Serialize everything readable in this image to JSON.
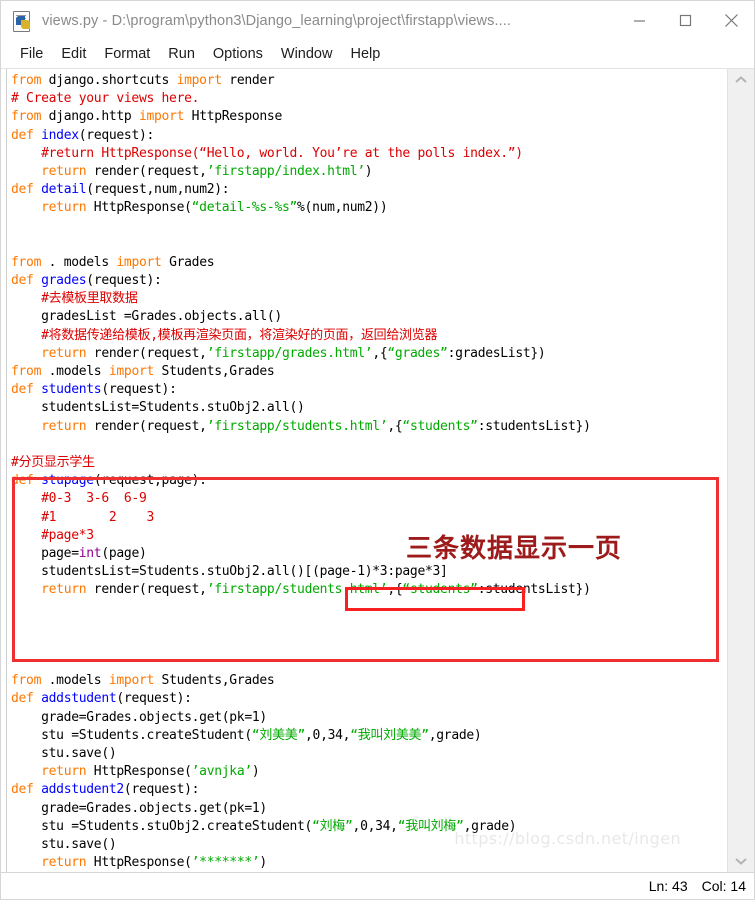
{
  "window": {
    "title": "views.py - D:\\program\\python3\\Django_learning\\project\\firstapp\\views....",
    "icon": "python-file-icon",
    "minimize_label": "—",
    "maximize_label": "□",
    "close_label": "✕"
  },
  "menubar": {
    "items": [
      {
        "label": "File"
      },
      {
        "label": "Edit"
      },
      {
        "label": "Format"
      },
      {
        "label": "Run"
      },
      {
        "label": "Options"
      },
      {
        "label": "Window"
      },
      {
        "label": "Help"
      }
    ]
  },
  "annotations": {
    "note_text": "三条数据显示一页",
    "note_color": "#9e1b1b",
    "outer_box_color": "#f03030",
    "inner_box_color": "#f82020",
    "watermark": "https://blog.csdn.net/ingen"
  },
  "statusbar": {
    "line_label": "Ln: 43",
    "col_label": "Col: 14"
  },
  "scrollbar": {
    "up_arrow": "chevron-up",
    "down_arrow": "chevron-down"
  },
  "colors": {
    "keyword": "#ff7700",
    "definition": "#0000ff",
    "string": "#00aa00",
    "comment": "#dd0000",
    "builtin": "#900090",
    "plain": "#000000"
  },
  "editor": {
    "lines": [
      {
        "n": 1,
        "segs": [
          {
            "t": "from",
            "c": "kw"
          },
          {
            "t": " django.shortcuts ",
            "c": "pl"
          },
          {
            "t": "import",
            "c": "kw"
          },
          {
            "t": " render",
            "c": "pl"
          }
        ]
      },
      {
        "n": 2,
        "segs": [
          {
            "t": "# Create your views here.",
            "c": "cmt"
          }
        ]
      },
      {
        "n": 3,
        "segs": [
          {
            "t": "from",
            "c": "kw"
          },
          {
            "t": " django.http ",
            "c": "pl"
          },
          {
            "t": "import",
            "c": "kw"
          },
          {
            "t": " HttpResponse",
            "c": "pl"
          }
        ]
      },
      {
        "n": 4,
        "segs": [
          {
            "t": "def",
            "c": "kw"
          },
          {
            "t": " ",
            "c": "pl"
          },
          {
            "t": "index",
            "c": "def"
          },
          {
            "t": "(request):",
            "c": "pl"
          }
        ]
      },
      {
        "n": 5,
        "segs": [
          {
            "t": "    #return HttpResponse(“Hello, world. You’re at the polls index.”)",
            "c": "cmt"
          }
        ]
      },
      {
        "n": 6,
        "segs": [
          {
            "t": "    ",
            "c": "pl"
          },
          {
            "t": "return",
            "c": "kw"
          },
          {
            "t": " render(request,",
            "c": "pl"
          },
          {
            "t": "’firstapp/index.html’",
            "c": "str"
          },
          {
            "t": ")",
            "c": "pl"
          }
        ]
      },
      {
        "n": 7,
        "segs": [
          {
            "t": "def",
            "c": "kw"
          },
          {
            "t": " ",
            "c": "pl"
          },
          {
            "t": "detail",
            "c": "def"
          },
          {
            "t": "(request,num,num2):",
            "c": "pl"
          }
        ]
      },
      {
        "n": 8,
        "segs": [
          {
            "t": "    ",
            "c": "pl"
          },
          {
            "t": "return",
            "c": "kw"
          },
          {
            "t": " HttpResponse(",
            "c": "pl"
          },
          {
            "t": "“detail-%s-%s”",
            "c": "str"
          },
          {
            "t": "%(num,num2))",
            "c": "pl"
          }
        ]
      },
      {
        "n": 9,
        "segs": []
      },
      {
        "n": 10,
        "segs": []
      },
      {
        "n": 11,
        "segs": [
          {
            "t": "from",
            "c": "kw"
          },
          {
            "t": " . models ",
            "c": "pl"
          },
          {
            "t": "import",
            "c": "kw"
          },
          {
            "t": " Grades",
            "c": "pl"
          }
        ]
      },
      {
        "n": 12,
        "segs": [
          {
            "t": "def",
            "c": "kw"
          },
          {
            "t": " ",
            "c": "pl"
          },
          {
            "t": "grades",
            "c": "def"
          },
          {
            "t": "(request):",
            "c": "pl"
          }
        ]
      },
      {
        "n": 13,
        "segs": [
          {
            "t": "    #去模板里取数据",
            "c": "cmt"
          }
        ]
      },
      {
        "n": 14,
        "segs": [
          {
            "t": "    gradesList =Grades.objects.all()",
            "c": "pl"
          }
        ]
      },
      {
        "n": 15,
        "segs": [
          {
            "t": "    #将数据传递给模板,模板再渲染页面，将渲染好的页面，返回给浏览器",
            "c": "cmt"
          }
        ]
      },
      {
        "n": 16,
        "segs": [
          {
            "t": "    ",
            "c": "pl"
          },
          {
            "t": "return",
            "c": "kw"
          },
          {
            "t": " render(request,",
            "c": "pl"
          },
          {
            "t": "’firstapp/grades.html’",
            "c": "str"
          },
          {
            "t": ",{",
            "c": "pl"
          },
          {
            "t": "“grades”",
            "c": "str"
          },
          {
            "t": ":gradesList})",
            "c": "pl"
          }
        ]
      },
      {
        "n": 17,
        "segs": [
          {
            "t": "from",
            "c": "kw"
          },
          {
            "t": " .models ",
            "c": "pl"
          },
          {
            "t": "import",
            "c": "kw"
          },
          {
            "t": " Students,Grades",
            "c": "pl"
          }
        ]
      },
      {
        "n": 18,
        "segs": [
          {
            "t": "def",
            "c": "kw"
          },
          {
            "t": " ",
            "c": "pl"
          },
          {
            "t": "students",
            "c": "def"
          },
          {
            "t": "(request):",
            "c": "pl"
          }
        ]
      },
      {
        "n": 19,
        "segs": [
          {
            "t": "    studentsList=Students.stuObj2.all()",
            "c": "pl"
          }
        ]
      },
      {
        "n": 20,
        "segs": [
          {
            "t": "    ",
            "c": "pl"
          },
          {
            "t": "return",
            "c": "kw"
          },
          {
            "t": " render(request,",
            "c": "pl"
          },
          {
            "t": "’firstapp/students.html’",
            "c": "str"
          },
          {
            "t": ",{",
            "c": "pl"
          },
          {
            "t": "“students”",
            "c": "str"
          },
          {
            "t": ":studentsList})",
            "c": "pl"
          }
        ]
      },
      {
        "n": 21,
        "segs": []
      },
      {
        "n": 22,
        "segs": [
          {
            "t": "#分页显示学生",
            "c": "cmt"
          }
        ]
      },
      {
        "n": 23,
        "segs": [
          {
            "t": "def",
            "c": "kw"
          },
          {
            "t": " ",
            "c": "pl"
          },
          {
            "t": "stupage",
            "c": "def"
          },
          {
            "t": "(request,page):",
            "c": "pl"
          }
        ]
      },
      {
        "n": 24,
        "segs": [
          {
            "t": "    #0-3  3-6  6-9",
            "c": "cmt"
          }
        ]
      },
      {
        "n": 25,
        "segs": [
          {
            "t": "    #1       2    3",
            "c": "cmt"
          }
        ]
      },
      {
        "n": 26,
        "segs": [
          {
            "t": "    #page*3",
            "c": "cmt"
          }
        ]
      },
      {
        "n": 27,
        "segs": [
          {
            "t": "    page=",
            "c": "pl"
          },
          {
            "t": "int",
            "c": "bi"
          },
          {
            "t": "(page)",
            "c": "pl"
          }
        ]
      },
      {
        "n": 28,
        "segs": [
          {
            "t": "    studentsList=Students.stuObj2.all()[(page-1)*3:page*3]",
            "c": "pl"
          }
        ]
      },
      {
        "n": 29,
        "segs": [
          {
            "t": "    ",
            "c": "pl"
          },
          {
            "t": "return",
            "c": "kw"
          },
          {
            "t": " render(request,",
            "c": "pl"
          },
          {
            "t": "’firstapp/students.html’",
            "c": "str"
          },
          {
            "t": ",{",
            "c": "pl"
          },
          {
            "t": "“students”",
            "c": "str"
          },
          {
            "t": ":studentsList})",
            "c": "pl"
          }
        ]
      },
      {
        "n": 30,
        "segs": []
      },
      {
        "n": 31,
        "segs": []
      },
      {
        "n": 32,
        "segs": []
      },
      {
        "n": 33,
        "segs": []
      },
      {
        "n": 34,
        "segs": [
          {
            "t": "from",
            "c": "kw"
          },
          {
            "t": " .models ",
            "c": "pl"
          },
          {
            "t": "import",
            "c": "kw"
          },
          {
            "t": " Students,Grades",
            "c": "pl"
          }
        ]
      },
      {
        "n": 35,
        "segs": [
          {
            "t": "def",
            "c": "kw"
          },
          {
            "t": " ",
            "c": "pl"
          },
          {
            "t": "addstudent",
            "c": "def"
          },
          {
            "t": "(request):",
            "c": "pl"
          }
        ]
      },
      {
        "n": 36,
        "segs": [
          {
            "t": "    grade=Grades.objects.get(pk=1)",
            "c": "pl"
          }
        ]
      },
      {
        "n": 37,
        "segs": [
          {
            "t": "    stu =Students.createStudent(",
            "c": "pl"
          },
          {
            "t": "“刘美美”",
            "c": "str"
          },
          {
            "t": ",0,34,",
            "c": "pl"
          },
          {
            "t": "“我叫刘美美”",
            "c": "str"
          },
          {
            "t": ",grade)",
            "c": "pl"
          }
        ]
      },
      {
        "n": 38,
        "segs": [
          {
            "t": "    stu.save()",
            "c": "pl"
          }
        ]
      },
      {
        "n": 39,
        "segs": [
          {
            "t": "    ",
            "c": "pl"
          },
          {
            "t": "return",
            "c": "kw"
          },
          {
            "t": " HttpResponse(",
            "c": "pl"
          },
          {
            "t": "’avnjka’",
            "c": "str"
          },
          {
            "t": ")",
            "c": "pl"
          }
        ]
      },
      {
        "n": 40,
        "segs": [
          {
            "t": "def",
            "c": "kw"
          },
          {
            "t": " ",
            "c": "pl"
          },
          {
            "t": "addstudent2",
            "c": "def"
          },
          {
            "t": "(request):",
            "c": "pl"
          }
        ]
      },
      {
        "n": 41,
        "segs": [
          {
            "t": "    grade=Grades.objects.get(pk=1)",
            "c": "pl"
          }
        ]
      },
      {
        "n": 42,
        "segs": [
          {
            "t": "    stu =Students.stuObj2.createStudent(",
            "c": "pl"
          },
          {
            "t": "“刘梅”",
            "c": "str"
          },
          {
            "t": ",0,34,",
            "c": "pl"
          },
          {
            "t": "“我叫刘梅”",
            "c": "str"
          },
          {
            "t": ",grade)",
            "c": "pl"
          }
        ]
      },
      {
        "n": 43,
        "segs": [
          {
            "t": "    stu.save()",
            "c": "pl"
          }
        ]
      },
      {
        "n": 44,
        "segs": [
          {
            "t": "    ",
            "c": "pl"
          },
          {
            "t": "return",
            "c": "kw"
          },
          {
            "t": " HttpResponse(",
            "c": "pl"
          },
          {
            "t": "’*******’",
            "c": "str"
          },
          {
            "t": ")",
            "c": "pl"
          }
        ]
      }
    ]
  }
}
